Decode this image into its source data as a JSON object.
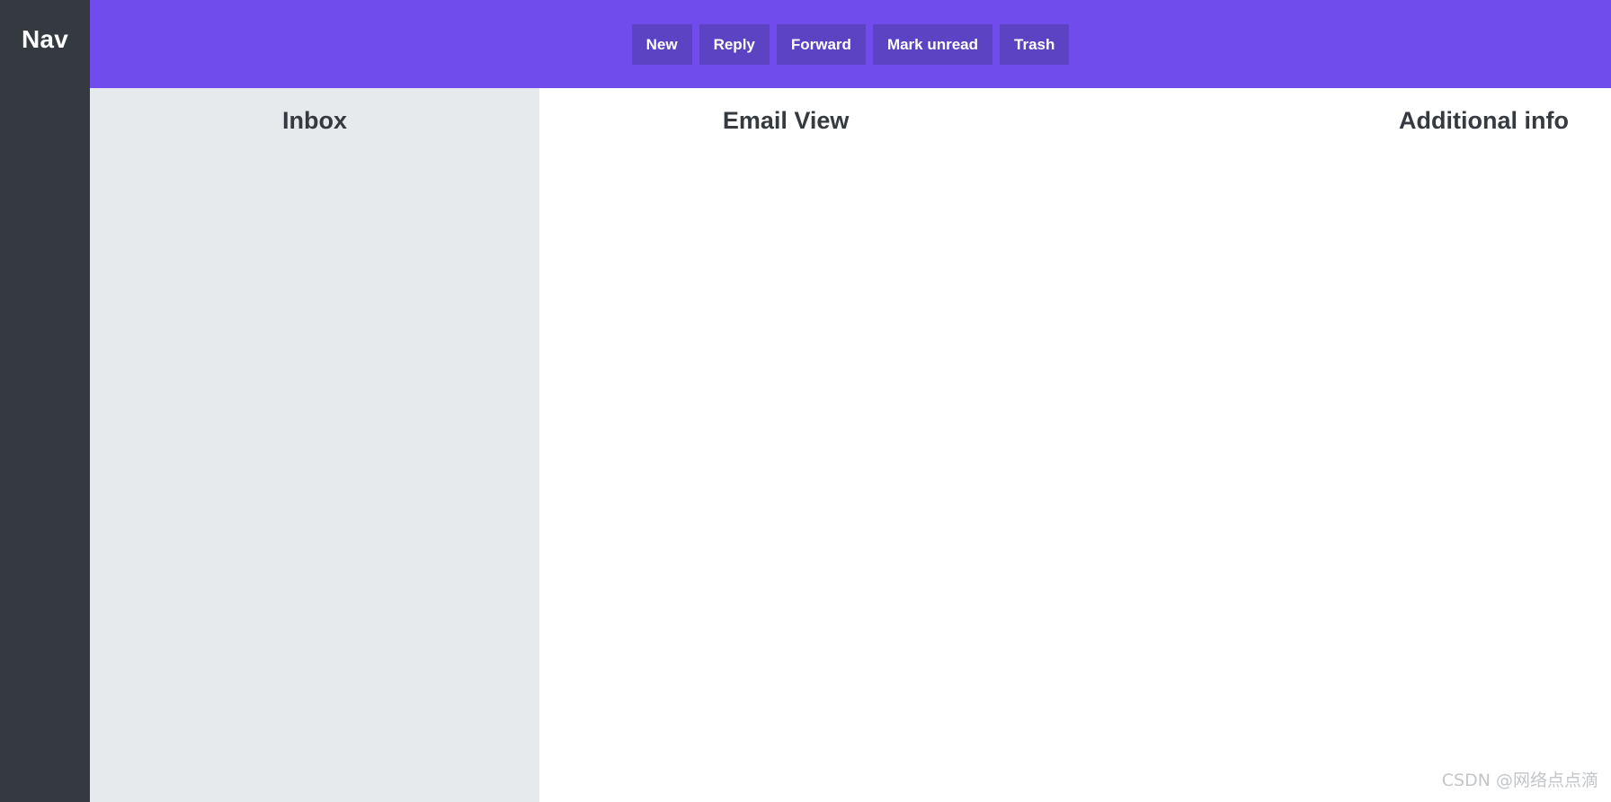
{
  "nav": {
    "label": "Nav",
    "background_color": "#343a40",
    "text_color": "#ffffff"
  },
  "toolbar": {
    "background_color": "#6f4ceb",
    "button_color": "#5b43c4",
    "button_text_color": "#ffffff",
    "buttons": [
      {
        "label": "New",
        "name": "new"
      },
      {
        "label": "Reply",
        "name": "reply"
      },
      {
        "label": "Forward",
        "name": "forward"
      },
      {
        "label": "Mark unread",
        "name": "mark-unread"
      },
      {
        "label": "Trash",
        "name": "trash"
      }
    ]
  },
  "columns": {
    "inbox": {
      "heading": "Inbox",
      "background_color": "#e7eaec",
      "align": "center"
    },
    "email_view": {
      "heading": "Email View",
      "background_color": "#ffffff",
      "align": "center"
    },
    "additional_info": {
      "heading": "Additional info",
      "background_color": "#ffffff",
      "align": "right"
    }
  },
  "heading_text_color": "#343a40",
  "watermark": {
    "text": "CSDN @网络点点滴",
    "color": "#c3c6c9"
  }
}
